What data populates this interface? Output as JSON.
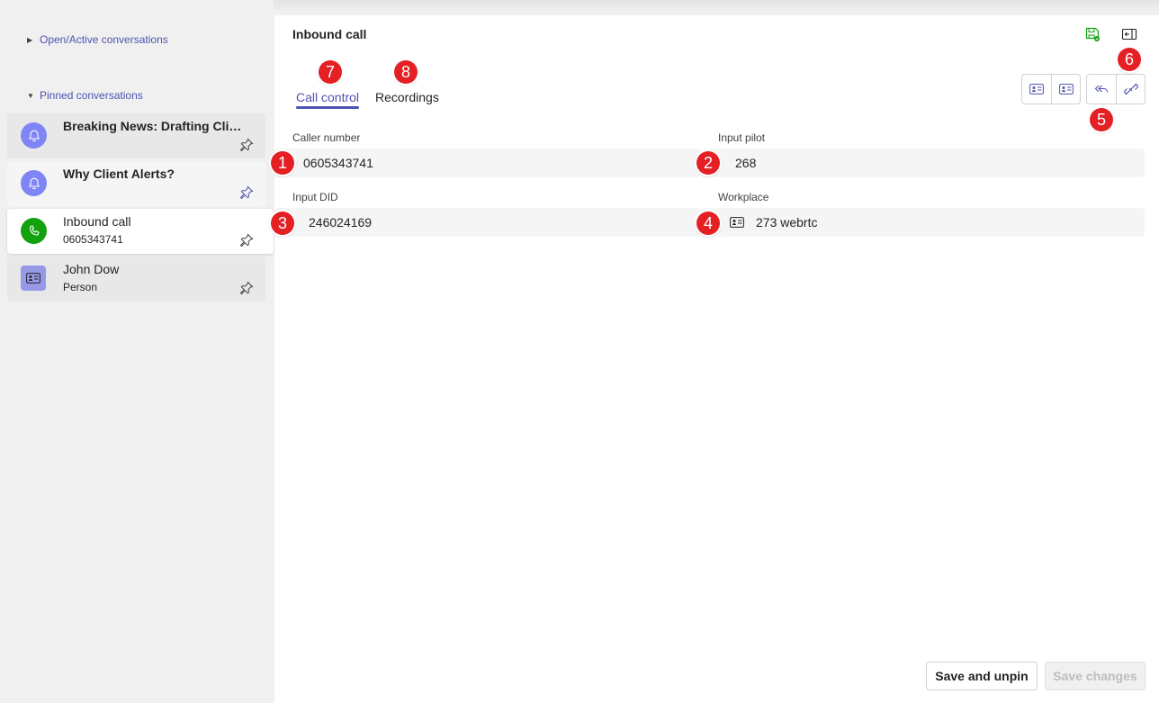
{
  "sidebar": {
    "open_header": "Open/Active conversations",
    "pinned_header": "Pinned conversations",
    "items": [
      {
        "title": "Breaking News: Drafting Clien...",
        "subtitle": "",
        "icon": "bell-icon"
      },
      {
        "title": "Why Client Alerts?",
        "subtitle": "",
        "icon": "bell-icon"
      },
      {
        "title": "Inbound call",
        "subtitle": "0605343741",
        "icon": "phone-icon"
      },
      {
        "title": "John Dow",
        "subtitle": "Person",
        "icon": "contact-card-icon"
      }
    ]
  },
  "header": {
    "title": "Inbound call",
    "save_icon": "save-icon",
    "panel_icon": "side-panel-icon"
  },
  "tabs": [
    {
      "label": "Call control",
      "active": true
    },
    {
      "label": "Recordings",
      "active": false
    }
  ],
  "fields": {
    "caller_number": {
      "label": "Caller number",
      "value": "0605343741"
    },
    "input_pilot": {
      "label": "Input pilot",
      "value": "268"
    },
    "input_did": {
      "label": "Input DID",
      "value": "246024169"
    },
    "workplace": {
      "label": "Workplace",
      "value": "273 webrtc"
    }
  },
  "annotations": [
    "1",
    "2",
    "3",
    "4",
    "5",
    "6",
    "7",
    "8"
  ],
  "footer": {
    "save_unpin": "Save and unpin",
    "save_changes": "Save changes"
  },
  "colors": {
    "accent": "#4f52b2",
    "badge": "#e42025",
    "call_green": "#13a10e",
    "bell_purple": "#7f85f5"
  }
}
